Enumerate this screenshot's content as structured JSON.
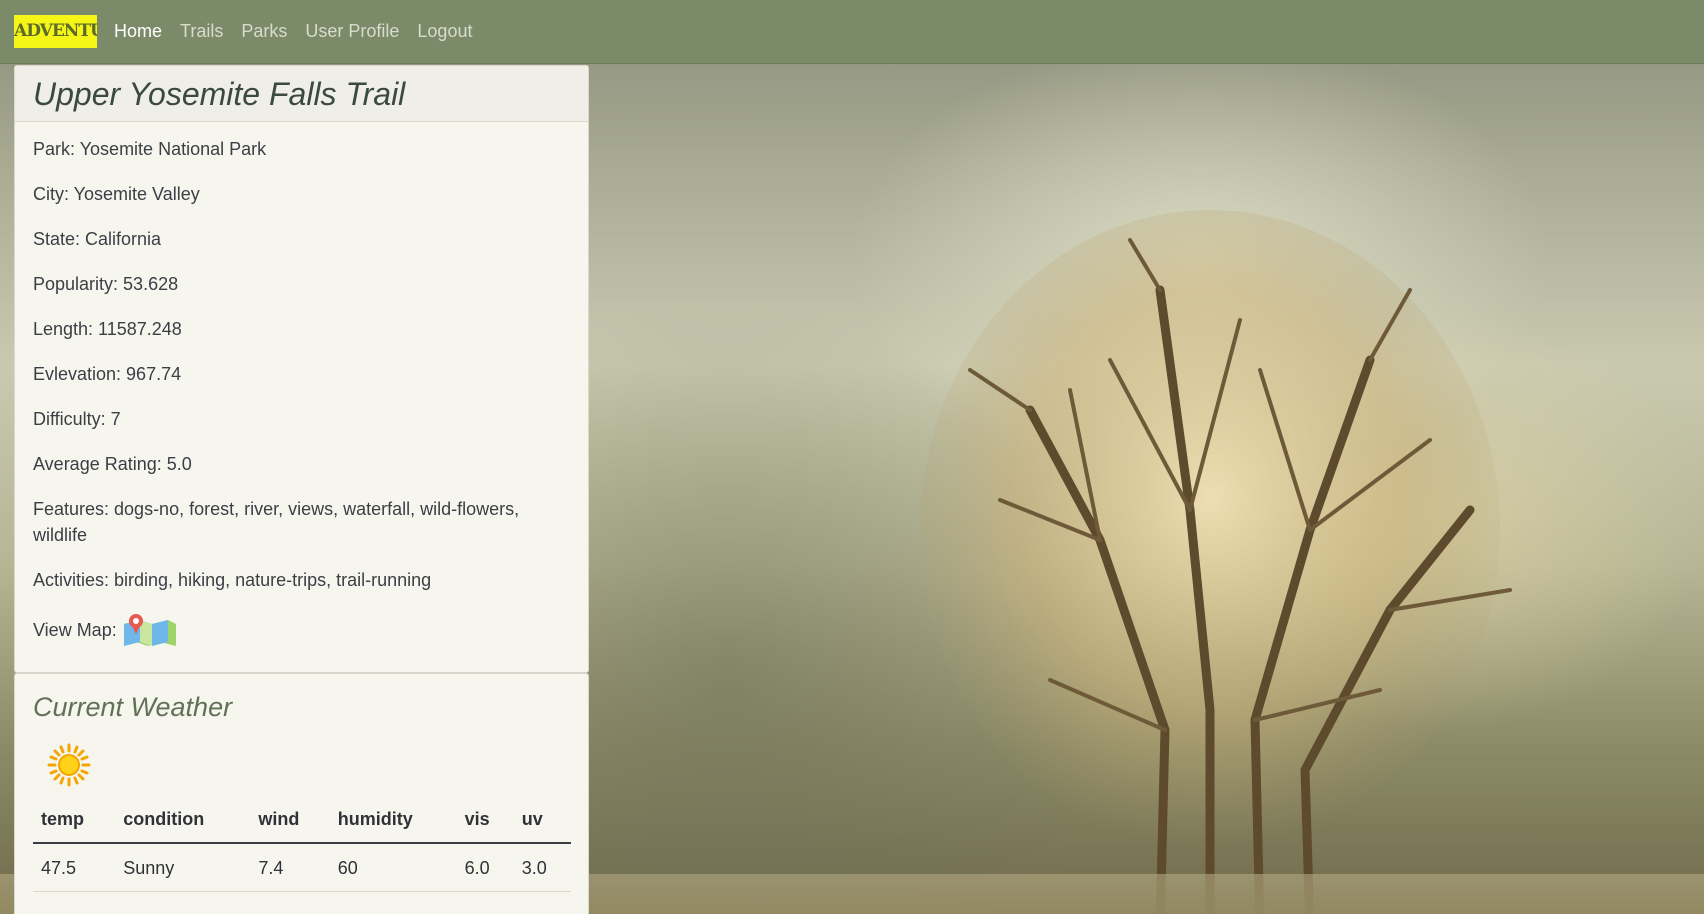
{
  "brand": {
    "logo_text": "ADVENTURE"
  },
  "nav": {
    "items": [
      {
        "label": "Home"
      },
      {
        "label": "Trails"
      },
      {
        "label": "Parks"
      },
      {
        "label": "User Profile"
      },
      {
        "label": "Logout"
      }
    ],
    "active": "Home"
  },
  "trail": {
    "name": "Upper Yosemite Falls Trail",
    "park": "Park: Yosemite National Park",
    "city": "City: Yosemite Valley",
    "state": "State: California",
    "popularity": "Popularity: 53.628",
    "length": "Length: 11587.248",
    "elevation": "Evlevation: 967.74",
    "difficulty": "Difficulty: 7",
    "rating": "Average Rating: 5.0",
    "features": "Features: dogs-no, forest, river, views, waterfall, wild-flowers, wildlife",
    "activities": "Activities: birding, hiking, nature-trips, trail-running",
    "map_label": "View Map:",
    "map_icon": "map-pin-icon"
  },
  "weather": {
    "title": "Current Weather",
    "condition_icon": "sun-icon",
    "columns": [
      "temp",
      "condition",
      "wind",
      "humidity",
      "vis",
      "uv"
    ],
    "row": [
      "47.5",
      "Sunny",
      "7.4",
      "60",
      "6.0",
      "3.0"
    ]
  },
  "colors": {
    "navbar": "#7b8a69",
    "logo_bg": "#f5f516",
    "card_bg": "#f7f6ee",
    "title_text": "#3b4a3e",
    "weather_title": "#607155"
  }
}
